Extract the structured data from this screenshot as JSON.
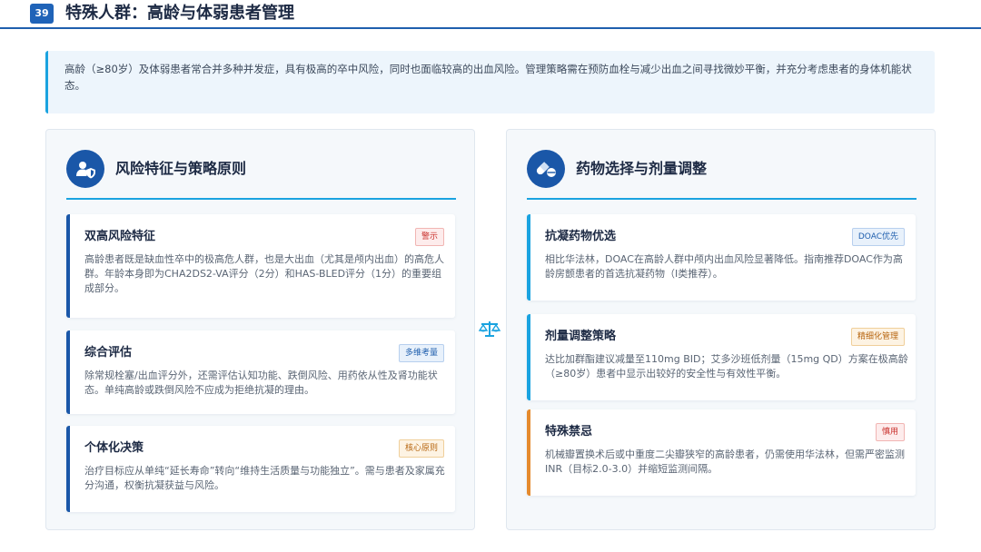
{
  "header": {
    "page_number": "39",
    "title": "特殊人群：高龄与体弱患者管理"
  },
  "intro": {
    "text": "高龄（≥80岁）及体弱患者常合并多种并发症，具有极高的卒中风险，同时也面临较高的出血风险。管理策略需在预防血栓与减少出血之间寻找微妙平衡，并充分考虑患者的身体机能状态。"
  },
  "left_panel": {
    "icon": "user-shield-icon",
    "title": "风险特征与策略原则",
    "cards": [
      {
        "title": "双高风险特征",
        "badge": "警示",
        "body": "高龄患者既是缺血性卒中的极高危人群，也是大出血（尤其是颅内出血）的高危人群。年龄本身即为CHA2DS2-VA评分（2分）和HAS-BLED评分（1分）的重要组成部分。"
      },
      {
        "title": "综合评估",
        "badge": "多维考量",
        "body": "除常规栓塞/出血评分外，还需评估认知功能、跌倒风险、用药依从性及肾功能状态。单纯高龄或跌倒风险不应成为拒绝抗凝的理由。"
      },
      {
        "title": "个体化决策",
        "badge": "核心原则",
        "body": "治疗目标应从单纯“延长寿命”转向“维持生活质量与功能独立”。需与患者及家属充分沟通，权衡抗凝获益与风险。"
      }
    ]
  },
  "right_panel": {
    "icon": "pills-icon",
    "title": "药物选择与剂量调整",
    "cards": [
      {
        "title": "抗凝药物优选",
        "badge": "DOAC优先",
        "body": "相比华法林，DOAC在高龄人群中颅内出血风险显著降低。指南推荐DOAC作为高龄房颤患者的首选抗凝药物（I类推荐）。"
      },
      {
        "title": "剂量调整策略",
        "badge": "精细化管理",
        "body": "达比加群酯建议减量至110mg BID；艾多沙班低剂量（15mg QD）方案在极高龄（≥80岁）患者中显示出较好的安全性与有效性平衡。"
      },
      {
        "title": "特殊禁忌",
        "badge": "慎用",
        "body": "机械瓣置换术后或中重度二尖瓣狭窄的高龄患者，仍需使用华法林，但需严密监测INR（目标2.0-3.0）并缩短监测间隔。"
      }
    ]
  },
  "center": {
    "icon": "balance-scale-icon"
  },
  "colors": {
    "primary": "#1a57a8",
    "accent": "#1aa3e0",
    "warning": "#e58a2d",
    "danger": "#c9302c"
  }
}
